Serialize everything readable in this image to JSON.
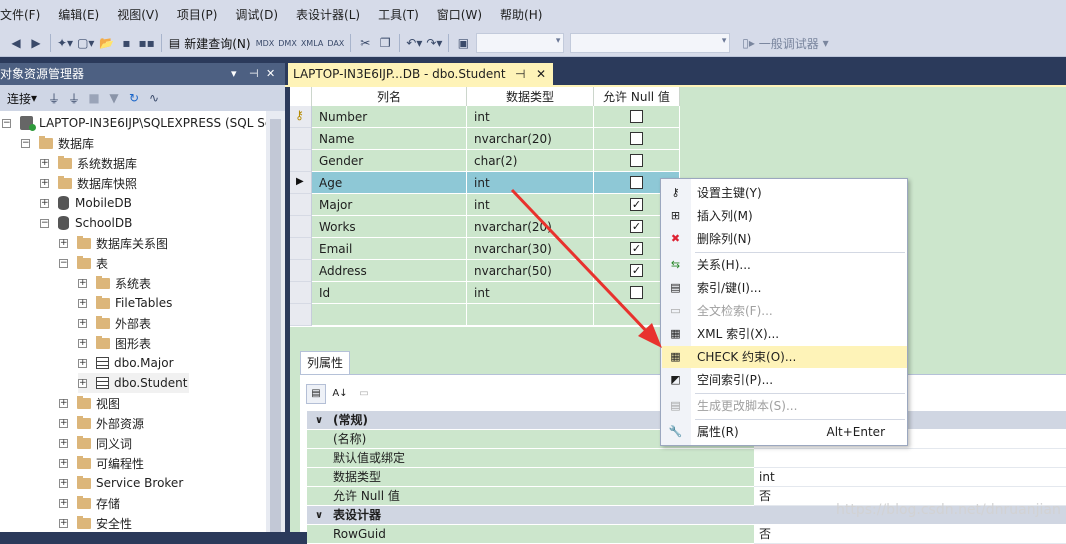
{
  "menu": [
    "文件(F)",
    "编辑(E)",
    "视图(V)",
    "项目(P)",
    "调试(D)",
    "表设计器(L)",
    "工具(T)",
    "窗口(W)",
    "帮助(H)"
  ],
  "toolbar": {
    "new_query": "新建查询(N)",
    "mdx": "MDX",
    "dmx": "DMX",
    "xmla": "XMLA",
    "dax": "DAX",
    "debugger": "一般调试器"
  },
  "object_explorer": {
    "title": "对象资源管理器",
    "connect": "连接",
    "tree": [
      {
        "label": "LAPTOP-IN3E6IJP\\SQLEXPRESS (SQL Se",
        "toggle": "−",
        "icon": "server-icon",
        "indent": 0
      },
      {
        "label": "数据库",
        "toggle": "−",
        "icon": "folder-icon",
        "indent": 1
      },
      {
        "label": "系统数据库",
        "toggle": "+",
        "icon": "folder-icon",
        "indent": 2
      },
      {
        "label": "数据库快照",
        "toggle": "+",
        "icon": "folder-icon",
        "indent": 2
      },
      {
        "label": "MobileDB",
        "toggle": "+",
        "icon": "database-icon",
        "indent": 2
      },
      {
        "label": "SchoolDB",
        "toggle": "−",
        "icon": "database-icon",
        "indent": 2
      },
      {
        "label": "数据库关系图",
        "toggle": "+",
        "icon": "folder-icon",
        "indent": 3
      },
      {
        "label": "表",
        "toggle": "−",
        "icon": "folder-icon",
        "indent": 3
      },
      {
        "label": "系统表",
        "toggle": "+",
        "icon": "folder-icon",
        "indent": 4
      },
      {
        "label": "FileTables",
        "toggle": "+",
        "icon": "folder-icon",
        "indent": 4
      },
      {
        "label": "外部表",
        "toggle": "+",
        "icon": "folder-icon",
        "indent": 4
      },
      {
        "label": "图形表",
        "toggle": "+",
        "icon": "folder-icon",
        "indent": 4
      },
      {
        "label": "dbo.Major",
        "toggle": "+",
        "icon": "table-icon",
        "indent": 4
      },
      {
        "label": "dbo.Student",
        "toggle": "+",
        "icon": "table-icon",
        "indent": 4
      },
      {
        "label": "视图",
        "toggle": "+",
        "icon": "folder-icon",
        "indent": 3
      },
      {
        "label": "外部资源",
        "toggle": "+",
        "icon": "folder-icon",
        "indent": 3
      },
      {
        "label": "同义词",
        "toggle": "+",
        "icon": "folder-icon",
        "indent": 3
      },
      {
        "label": "可编程性",
        "toggle": "+",
        "icon": "folder-icon",
        "indent": 3
      },
      {
        "label": "Service Broker",
        "toggle": "+",
        "icon": "folder-icon",
        "indent": 3
      },
      {
        "label": "存储",
        "toggle": "+",
        "icon": "folder-icon",
        "indent": 3
      },
      {
        "label": "安全性",
        "toggle": "+",
        "icon": "folder-icon",
        "indent": 3
      }
    ]
  },
  "doc_tab": {
    "title": "LAPTOP-IN3E6IJP...DB - dbo.Student",
    "pin": "⊣",
    "close": "✕"
  },
  "grid": {
    "headers": [
      "列名",
      "数据类型",
      "允许 Null 值"
    ],
    "rows": [
      {
        "name": "Number",
        "type": "int",
        "nullable": false,
        "key": true
      },
      {
        "name": "Name",
        "type": "nvarchar(20)",
        "nullable": false
      },
      {
        "name": "Gender",
        "type": "char(2)",
        "nullable": false
      },
      {
        "name": "Age",
        "type": "int",
        "nullable": false,
        "selected": true
      },
      {
        "name": "Major",
        "type": "int",
        "nullable": true
      },
      {
        "name": "Works",
        "type": "nvarchar(20)",
        "nullable": true
      },
      {
        "name": "Email",
        "type": "nvarchar(30)",
        "nullable": true
      },
      {
        "name": "Address",
        "type": "nvarchar(50)",
        "nullable": true
      },
      {
        "name": "Id",
        "type": "int",
        "nullable": false
      },
      {
        "name": "",
        "type": "",
        "nullable": false,
        "blank": true
      }
    ]
  },
  "properties": {
    "tab": "列属性",
    "rows": [
      {
        "k": "(常规)",
        "v": "",
        "section": true,
        "exp": "∨"
      },
      {
        "k": "(名称)",
        "v": ""
      },
      {
        "k": "默认值或绑定",
        "v": ""
      },
      {
        "k": "数据类型",
        "v": "int"
      },
      {
        "k": "允许 Null 值",
        "v": "否"
      },
      {
        "k": "表设计器",
        "v": "",
        "section": true,
        "exp": "∨"
      },
      {
        "k": "RowGuid",
        "v": "否"
      }
    ]
  },
  "context_menu": [
    {
      "label": "设置主键(Y)",
      "icon": "key-icon",
      "glyph": "⚷"
    },
    {
      "label": "插入列(M)",
      "icon": "insert-column-icon",
      "glyph": "⊞"
    },
    {
      "label": "删除列(N)",
      "icon": "delete-column-icon",
      "glyph": "✖"
    },
    {
      "sep": true
    },
    {
      "label": "关系(H)...",
      "icon": "relationship-icon",
      "glyph": "⇆"
    },
    {
      "label": "索引/键(I)...",
      "icon": "index-icon",
      "glyph": "▤"
    },
    {
      "label": "全文检索(F)...",
      "icon": "fulltext-icon",
      "glyph": "▭",
      "disabled": true
    },
    {
      "label": "XML 索引(X)...",
      "icon": "xml-index-icon",
      "glyph": "▦"
    },
    {
      "label": "CHECK 约束(O)...",
      "icon": "check-constraint-icon",
      "glyph": "▦",
      "highlight": true
    },
    {
      "label": "空间索引(P)...",
      "icon": "spatial-index-icon",
      "glyph": "◩"
    },
    {
      "sep": true
    },
    {
      "label": "生成更改脚本(S)...",
      "icon": "script-icon",
      "glyph": "▤",
      "disabled": true
    },
    {
      "sep": true
    },
    {
      "label": "属性(R)",
      "icon": "wrench-icon",
      "glyph": "🔧",
      "shortcut": "Alt+Enter"
    }
  ],
  "watermark": "https://blog.csdn.net/dnruanjian",
  "colors": {
    "grid_green": "#cce6cc",
    "selection": "#8ec8d6",
    "highlight": "#fef3b8",
    "annotation_arrow": "#e8322d"
  }
}
